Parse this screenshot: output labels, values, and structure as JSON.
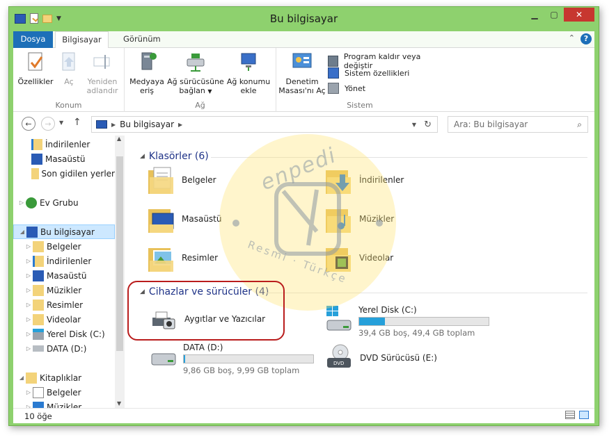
{
  "window": {
    "title": "Bu bilgisayar"
  },
  "tabs": {
    "file": "Dosya",
    "computer": "Bilgisayar",
    "view": "Görünüm"
  },
  "ribbon": {
    "location": {
      "name": "Konum",
      "properties": "Özellikler",
      "open": "Aç",
      "rename_line1": "Yeniden",
      "rename_line2": "adlandır"
    },
    "network": {
      "name": "Ağ",
      "media_line1": "Medyaya",
      "media_line2": "eriş",
      "map_line1": "Ağ sürücüsüne",
      "map_line2": "bağlan",
      "add_line1": "Ağ konumu",
      "add_line2": "ekle"
    },
    "system": {
      "name": "Sistem",
      "cp_line1": "Denetim",
      "cp_line2": "Masası'nı Aç",
      "uninstall": "Program kaldır veya değiştir",
      "sysprops": "Sistem özellikleri",
      "manage": "Yönet"
    }
  },
  "nav": {
    "breadcrumb": "Bu bilgisayar",
    "search_placeholder": "Ara: Bu bilgisayar"
  },
  "sidebar": {
    "items": [
      {
        "label": "İndirilenler"
      },
      {
        "label": "Masaüstü"
      },
      {
        "label": "Son gidilen yerler"
      },
      {
        "label": "Ev Grubu"
      },
      {
        "label": "Bu bilgisayar"
      },
      {
        "label": "Belgeler"
      },
      {
        "label": "İndirilenler"
      },
      {
        "label": "Masaüstü"
      },
      {
        "label": "Müzikler"
      },
      {
        "label": "Resimler"
      },
      {
        "label": "Videolar"
      },
      {
        "label": "Yerel Disk (C:)"
      },
      {
        "label": "DATA (D:)"
      },
      {
        "label": "Kitaplıklar"
      },
      {
        "label": "Belgeler"
      },
      {
        "label": "Müzikler"
      }
    ]
  },
  "content": {
    "folders_header": "Klasörler (6)",
    "folders": [
      {
        "label": "Belgeler"
      },
      {
        "label": "İndirilenler"
      },
      {
        "label": "Masaüstü"
      },
      {
        "label": "Müzikler"
      },
      {
        "label": "Resimler"
      },
      {
        "label": "Videolar"
      }
    ],
    "devices_header": "Cihazlar ve sürücüler (4)",
    "devices": {
      "printers": "Aygıtlar ve Yazıcılar",
      "c_label": "Yerel Disk (C:)",
      "c_info": "39,4 GB boş, 49,4 GB toplam",
      "c_used_fraction": 0.2,
      "d_label": "DATA (D:)",
      "d_info": "9,86 GB boş, 9,99 GB toplam",
      "d_used_fraction": 0.013,
      "e_label": "DVD Sürücüsü (E:)"
    }
  },
  "watermark": {
    "brand": "enpedi",
    "tagline": "Resmi · Türkçe"
  },
  "status": {
    "count": "10 öğe"
  },
  "colors": {
    "accent": "#1d6fb8",
    "frame": "#8ed16e",
    "drive_bar": "#26a0da",
    "highlight": "#b91c1c"
  }
}
